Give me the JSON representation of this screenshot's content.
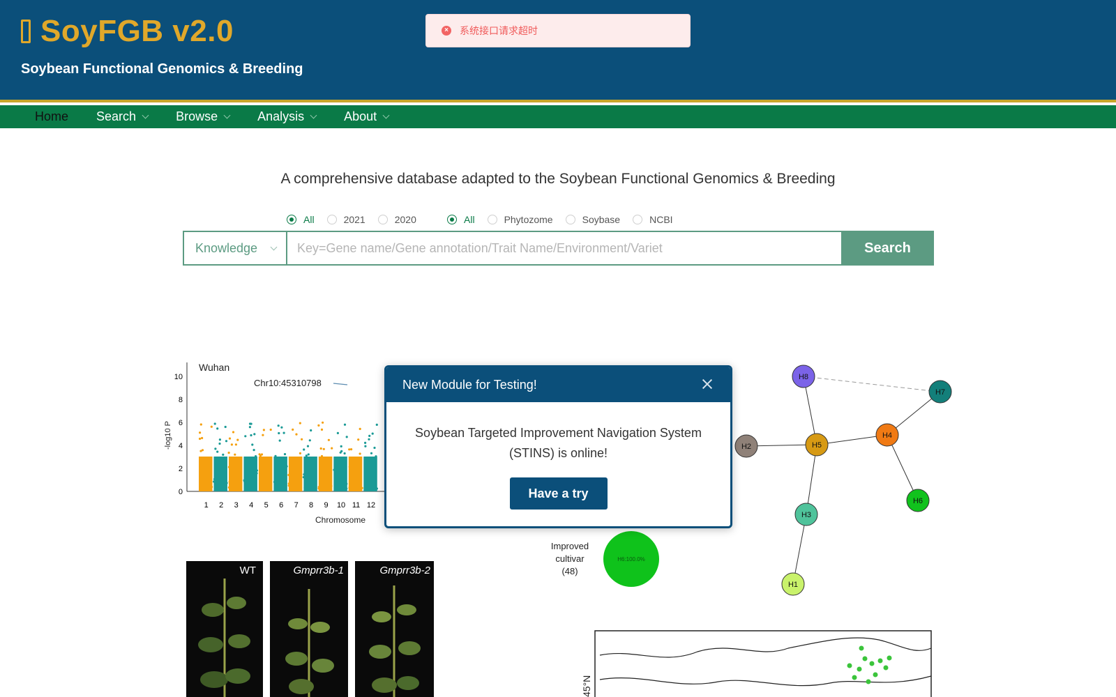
{
  "header": {
    "logo_icon": "box-icon",
    "title": "SoyFGB v2.0",
    "subtitle": "Soybean Functional Genomics & Breeding",
    "brand_color": "#0b4f7a",
    "title_color": "#e0a82a"
  },
  "toast": {
    "icon": "error-circle-icon",
    "message": "系统接口请求超时",
    "color": "#f05a5a"
  },
  "nav": {
    "color": "#0a7a47",
    "items": [
      {
        "label": "Home"
      },
      {
        "label": "Search"
      },
      {
        "label": "Browse"
      },
      {
        "label": "Analysis"
      },
      {
        "label": "About"
      }
    ]
  },
  "main": {
    "tagline": "A comprehensive database adapted to the Soybean Functional Genomics & Breeding",
    "year_filter": {
      "options": [
        "All",
        "2021",
        "2020"
      ],
      "selected": "All"
    },
    "source_filter": {
      "options": [
        "All",
        "Phytozome",
        "Soybase",
        "NCBI"
      ],
      "selected": "All"
    },
    "search": {
      "category": "Knowledge",
      "placeholder": "Key=Gene name/Gene annotation/Trait Name/Environment/Variet",
      "button": "Search"
    }
  },
  "figures": {
    "manhattan": {
      "location": "Wuhan",
      "annotation": "Chr10:45310798",
      "ylabel": "-log10 P",
      "xlabel": "Chromosome",
      "y_ticks": [
        "0",
        "2",
        "4",
        "6",
        "8",
        "10"
      ],
      "x_ticks": [
        "1",
        "2",
        "3",
        "4",
        "5",
        "6",
        "7",
        "8",
        "9",
        "10",
        "11",
        "12"
      ]
    },
    "network": {
      "nodes": [
        "H8",
        "H7",
        "H2",
        "H5",
        "H4",
        "H3",
        "H6",
        "H1"
      ]
    },
    "pie": {
      "label_lines": [
        "Improved",
        "cultivar",
        "(48)"
      ],
      "slice_label": "H6:100.0%"
    },
    "plants": {
      "labels": [
        "WT",
        "Gmprr3b-1",
        "Gmprr3b-2"
      ]
    },
    "map": {
      "lat_label": "45°N"
    }
  },
  "modal": {
    "title": "New Module for Testing!",
    "body_line1": "Soybean Targeted Improvement Navigation System",
    "body_line2": "(STINS) is online!",
    "button": "Have a try"
  }
}
